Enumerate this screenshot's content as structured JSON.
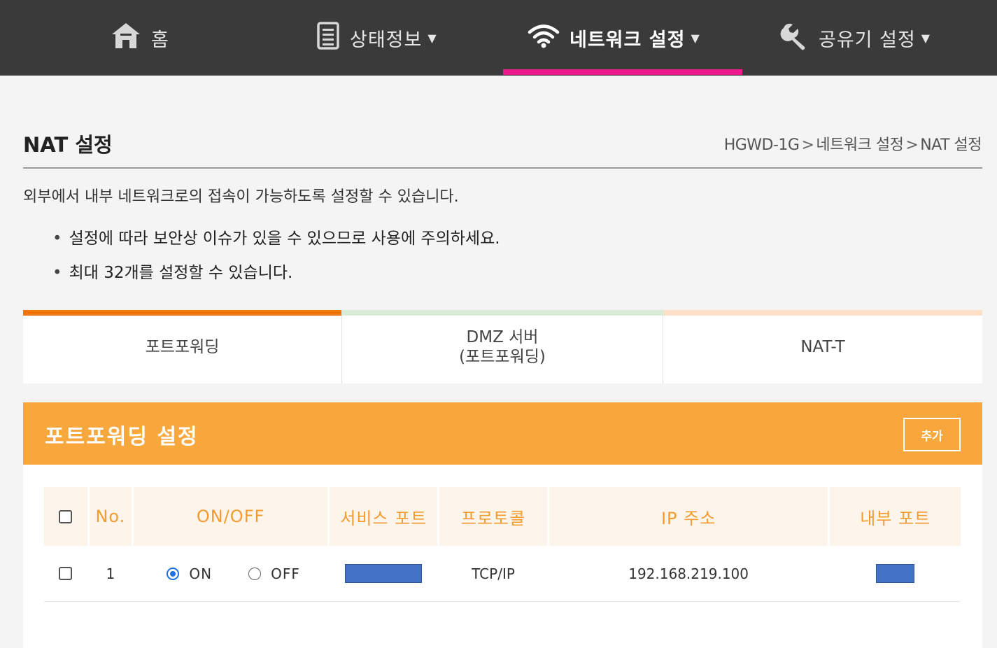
{
  "nav": {
    "items": [
      {
        "label": "홈",
        "icon": "home-icon"
      },
      {
        "label": "상태정보",
        "icon": "document-icon",
        "caret": "▼"
      },
      {
        "label": "네트워크 설정",
        "icon": "wifi-icon",
        "caret": "▼"
      },
      {
        "label": "공유기 설정",
        "icon": "wrench-icon",
        "caret": "▼"
      }
    ],
    "active": "네트워크 설정",
    "active_color": "#ec1a8c"
  },
  "header": {
    "title": "NAT 설정",
    "breadcrumb": [
      "HGWD-1G",
      "네트워크 설정",
      "NAT 설정"
    ],
    "breadcrumb_separator": ">"
  },
  "description": "외부에서 내부 네트워크로의 접속이 가능하도록 설정할 수 있습니다.",
  "notes": [
    "설정에 따라 보안상 이슈가 있을 수 있으므로 사용에 주의하세요.",
    "최대 32개를 설정할 수 있습니다."
  ],
  "tabs": [
    {
      "line1": "포트포워딩",
      "line2": "",
      "accent": "#f0750a"
    },
    {
      "line1": "DMZ 서버",
      "line2": "(포트포워딩)",
      "accent": "#d9ecd5"
    },
    {
      "line1": "NAT-T",
      "line2": "",
      "accent": "#fde0c8"
    }
  ],
  "panel": {
    "title": "포트포워딩 설정",
    "add_label": "추가",
    "color": "#f8a73c"
  },
  "table": {
    "columns": [
      "",
      "No.",
      "ON/OFF",
      "서비스 포트",
      "프로토콜",
      "IP 주소",
      "내부 포트"
    ],
    "rows": [
      {
        "no": "1",
        "on_label": "ON",
        "off_label": "OFF",
        "state": "ON",
        "protocol": "TCP/IP",
        "ip": "192.168.219.100"
      }
    ],
    "redaction_color": "#4472c4"
  }
}
